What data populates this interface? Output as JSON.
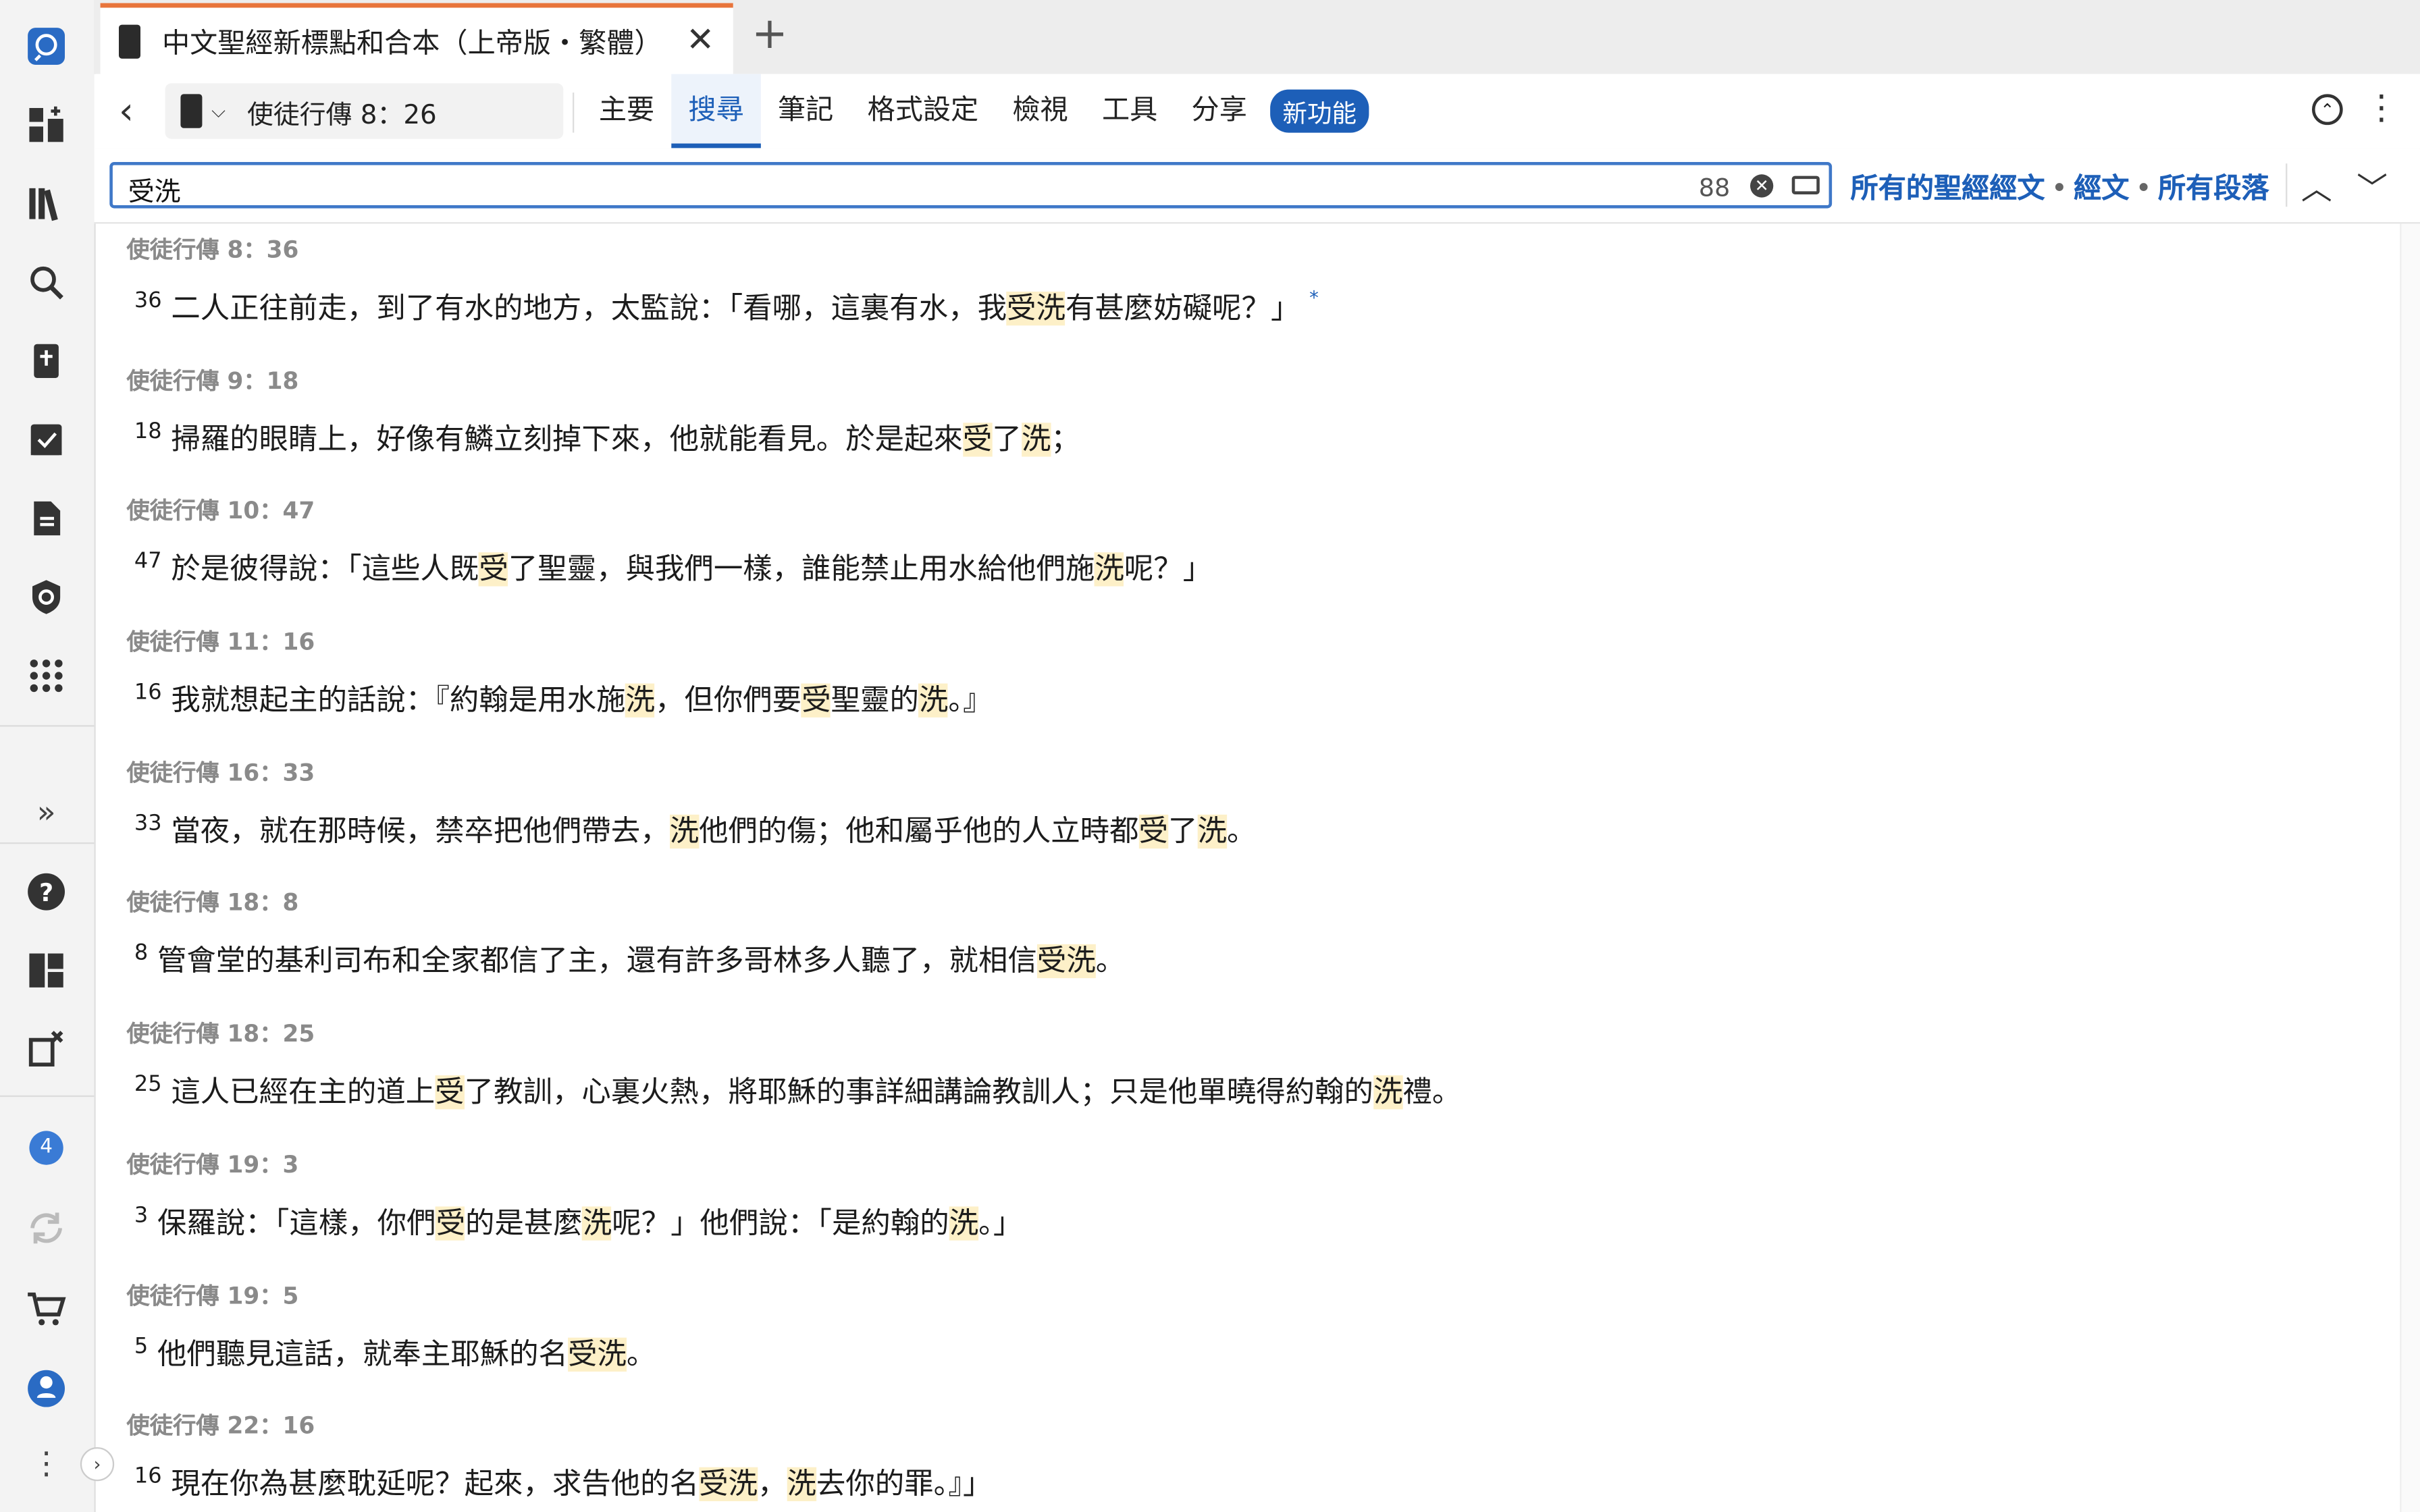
{
  "tab": {
    "title": "中文聖經新標點和合本（上帝版・繁體）",
    "close": "✕",
    "add": "+"
  },
  "toolbar": {
    "back": "‹",
    "reference": "使徒行傳 8：26",
    "menu": [
      "主要",
      "搜尋",
      "筆記",
      "格式設定",
      "檢視",
      "工具",
      "分享"
    ],
    "new_badge": "新功能"
  },
  "search": {
    "value": "受洗",
    "count": "88",
    "scope": [
      "所有的聖經經文",
      "經文",
      "所有段落"
    ]
  },
  "rail": {
    "badge_count": "4"
  },
  "results": [
    {
      "ref": "使徒行傳 8：36",
      "num": "36",
      "segments": [
        {
          "t": "二人正往前走，到了有水的地方，太監說：「看哪，這裏有水，我"
        },
        {
          "t": "受洗",
          "hl": true
        },
        {
          "t": "有甚麼妨礙呢？」"
        },
        {
          "t": "*"
        }
      ]
    },
    {
      "ref": "使徒行傳 9：18",
      "num": "18",
      "segments": [
        {
          "t": "掃羅的眼睛上，好像有鱗立刻掉下來，他就能看見。於是起來"
        },
        {
          "t": "受",
          "hl": true
        },
        {
          "t": "了"
        },
        {
          "t": "洗",
          "hl": true
        },
        {
          "t": "；"
        }
      ]
    },
    {
      "ref": "使徒行傳 10：47",
      "num": "47",
      "segments": [
        {
          "t": "於是彼得說：「這些人既"
        },
        {
          "t": "受",
          "hl": true
        },
        {
          "t": "了聖靈，與我們一樣，誰能禁止用水給他們施"
        },
        {
          "t": "洗",
          "hl": true
        },
        {
          "t": "呢？」"
        }
      ]
    },
    {
      "ref": "使徒行傳 11：16",
      "num": "16",
      "segments": [
        {
          "t": "我就想起主的話說：『約翰是用水施"
        },
        {
          "t": "洗",
          "hl": true
        },
        {
          "t": "，但你們要"
        },
        {
          "t": "受",
          "hl": true
        },
        {
          "t": "聖靈的"
        },
        {
          "t": "洗",
          "hl": true
        },
        {
          "t": "。』"
        }
      ]
    },
    {
      "ref": "使徒行傳 16：33",
      "num": "33",
      "segments": [
        {
          "t": "當夜，就在那時候，禁卒把他們帶去，"
        },
        {
          "t": "洗",
          "hl": true
        },
        {
          "t": "他們的傷；他和屬乎他的人立時都"
        },
        {
          "t": "受",
          "hl": true
        },
        {
          "t": "了"
        },
        {
          "t": "洗",
          "hl": true
        },
        {
          "t": "。"
        }
      ]
    },
    {
      "ref": "使徒行傳 18：8",
      "num": "8",
      "segments": [
        {
          "t": "管會堂的基利司布和全家都信了主，還有許多哥林多人聽了，就相信"
        },
        {
          "t": "受洗",
          "hl": true
        },
        {
          "t": "。"
        }
      ]
    },
    {
      "ref": "使徒行傳 18：25",
      "num": "25",
      "segments": [
        {
          "t": "這人已經在主的道上"
        },
        {
          "t": "受",
          "hl": true
        },
        {
          "t": "了教訓，心裏火熱，將耶穌的事詳細講論教訓人；只是他單曉得約翰的"
        },
        {
          "t": "洗",
          "hl": true
        },
        {
          "t": "禮。"
        }
      ]
    },
    {
      "ref": "使徒行傳 19：3",
      "num": "3",
      "segments": [
        {
          "t": "保羅說：「這樣，你們"
        },
        {
          "t": "受",
          "hl": true
        },
        {
          "t": "的是甚麼"
        },
        {
          "t": "洗",
          "hl": true
        },
        {
          "t": "呢？」他們說：「是約翰的"
        },
        {
          "t": "洗",
          "hl": true
        },
        {
          "t": "。」"
        }
      ]
    },
    {
      "ref": "使徒行傳 19：5",
      "num": "5",
      "segments": [
        {
          "t": "他們聽見這話，就奉主耶穌的名"
        },
        {
          "t": "受洗",
          "hl": true
        },
        {
          "t": "。"
        }
      ]
    },
    {
      "ref": "使徒行傳 22：16",
      "num": "16",
      "segments": [
        {
          "t": "現在你為甚麼耽延呢？起來，求告他的名"
        },
        {
          "t": "受洗",
          "hl": true
        },
        {
          "t": "，"
        },
        {
          "t": "洗",
          "hl": true
        },
        {
          "t": "去你的罪。』」"
        }
      ]
    }
  ],
  "colors": {
    "accent": "#1d5fb8",
    "tab_accent": "#e8743b",
    "highlight": "#fdf0c8"
  }
}
